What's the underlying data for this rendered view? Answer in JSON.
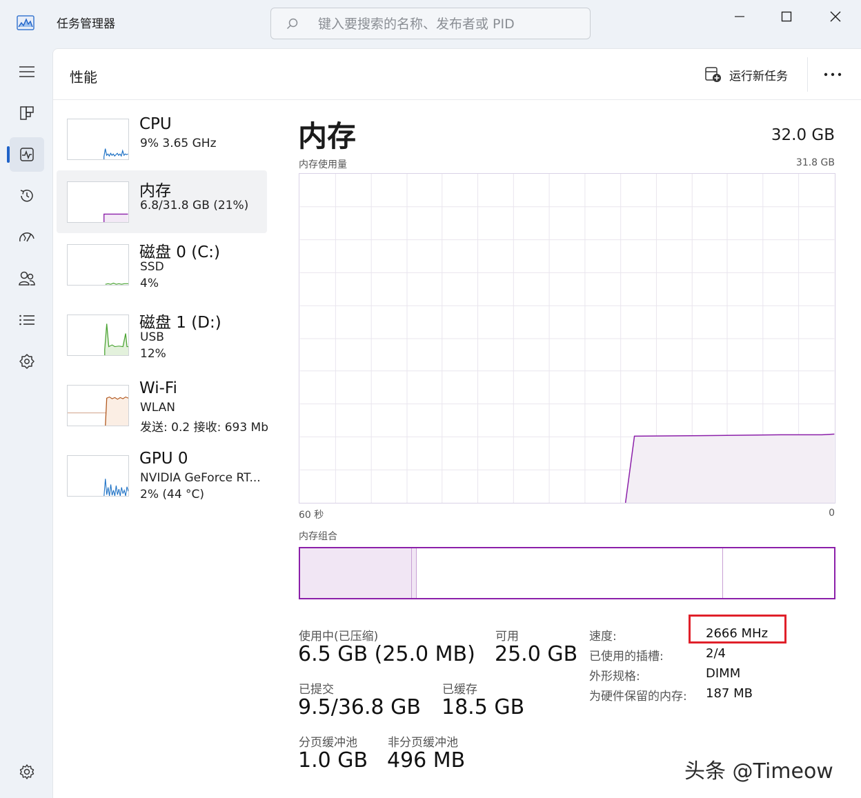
{
  "window": {
    "title": "任务管理器",
    "search_placeholder": "键入要搜索的名称、发布者或 PID"
  },
  "header": {
    "page_title": "性能",
    "run_task_label": "运行新任务"
  },
  "nav_icons": [
    "hamburger-icon",
    "processes-icon",
    "performance-icon",
    "history-icon",
    "startup-icon",
    "users-icon",
    "details-icon",
    "services-icon",
    "settings-icon"
  ],
  "devices": [
    {
      "name": "CPU",
      "line1": "9%  3.65 GHz",
      "line2": "",
      "color": "#1a6fc4"
    },
    {
      "name": "内存",
      "line1": "6.8/31.8 GB (21%)",
      "line2": "",
      "color": "#8b1fa9"
    },
    {
      "name": "磁盘 0 (C:)",
      "line1": "SSD",
      "line2": "4%",
      "color": "#4aa332"
    },
    {
      "name": "磁盘 1 (D:)",
      "line1": "USB",
      "line2": "12%",
      "color": "#4aa332"
    },
    {
      "name": "Wi-Fi",
      "line1": "WLAN",
      "line2": "发送: 0.2 接收: 693 Mb",
      "color": "#b0561c"
    },
    {
      "name": "GPU 0",
      "line1": "NVIDIA GeForce RT...",
      "line2": "2%  (44 °C)",
      "color": "#1a6fc4"
    }
  ],
  "memory": {
    "title": "内存",
    "total": "32.0 GB",
    "usage_label": "内存使用量",
    "usage_max": "31.8 GB",
    "time_left": "60 秒",
    "time_right": "0",
    "composition_label": "内存组合",
    "in_use_label": "使用中(已压缩)",
    "in_use_value": "6.5 GB (25.0 MB)",
    "available_label": "可用",
    "available_value": "25.0 GB",
    "committed_label": "已提交",
    "committed_value": "9.5/36.8 GB",
    "cached_label": "已缓存",
    "cached_value": "18.5 GB",
    "paged_label": "分页缓冲池",
    "paged_value": "1.0 GB",
    "nonpaged_label": "非分页缓冲池",
    "nonpaged_value": "496 MB",
    "speed_label": "速度:",
    "speed_value": "2666 MHz",
    "slots_label": "已使用的插槽:",
    "slots_value": "2/4",
    "form_label": "外形规格:",
    "form_value": "DIMM",
    "reserved_label": "为硬件保留的内存:",
    "reserved_value": "187 MB",
    "accent_color": "#8b1fa9",
    "usage_fraction": 0.21
  },
  "watermark": "头条 @Timeow"
}
